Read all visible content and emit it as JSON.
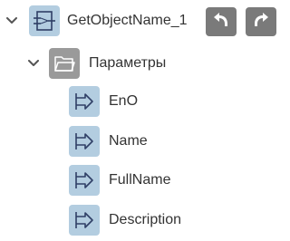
{
  "tree": {
    "root": {
      "label": "GetObjectName_1",
      "icon": "function-block-icon",
      "expanded": true
    },
    "folder": {
      "label": "Параметры",
      "icon": "folder-icon",
      "expanded": true
    },
    "params": [
      {
        "label": "EnO",
        "icon": "output-param-icon"
      },
      {
        "label": "Name",
        "icon": "output-param-icon"
      },
      {
        "label": "FullName",
        "icon": "output-param-icon"
      },
      {
        "label": "Description",
        "icon": "output-param-icon"
      }
    ]
  },
  "toolbar": {
    "back_icon": "back-arrow-icon",
    "forward_icon": "forward-arrow-icon"
  },
  "colors": {
    "icon_bg_blue": "#b3cde0",
    "icon_stroke_blue": "#2f3f66",
    "folder_bg": "#9a9a9a",
    "nav_button_bg": "#7a7a7a",
    "text": "#333333"
  }
}
